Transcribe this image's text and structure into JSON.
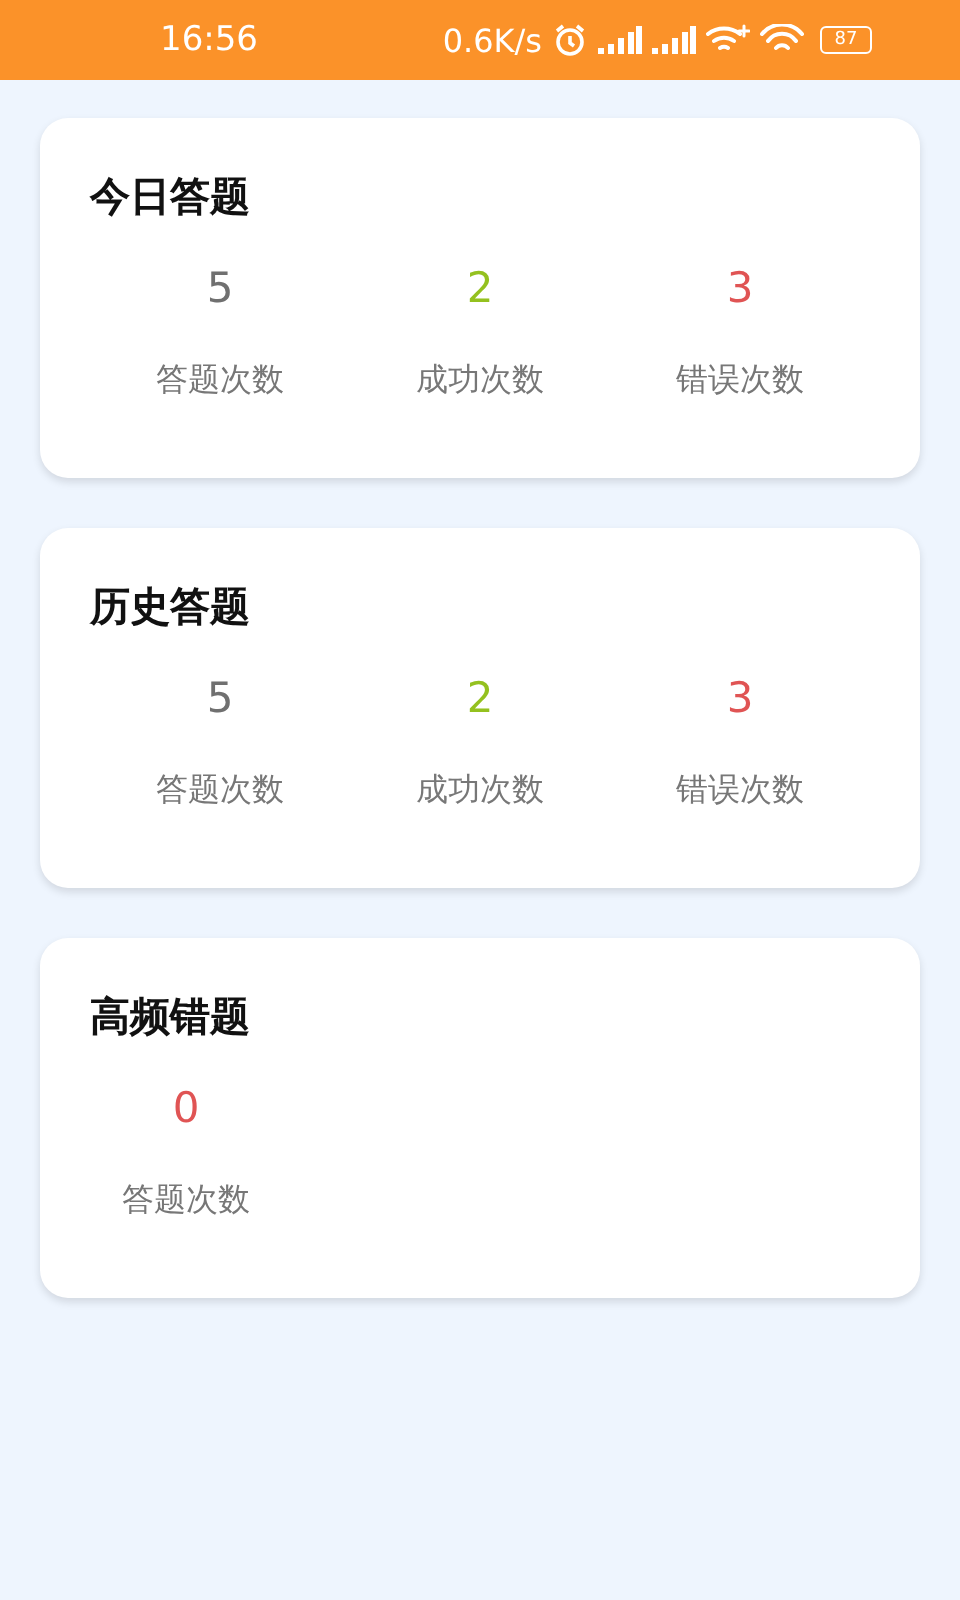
{
  "status_bar": {
    "time": "16:56",
    "speed": "0.6K/s",
    "battery": "87"
  },
  "cards": [
    {
      "title": "今日答题",
      "stats": [
        {
          "value": "5",
          "label": "答题次数",
          "color": "#707070"
        },
        {
          "value": "2",
          "label": "成功次数",
          "color": "#94c11f"
        },
        {
          "value": "3",
          "label": "错误次数",
          "color": "#e05454"
        }
      ]
    },
    {
      "title": "历史答题",
      "stats": [
        {
          "value": "5",
          "label": "答题次数",
          "color": "#707070"
        },
        {
          "value": "2",
          "label": "成功次数",
          "color": "#94c11f"
        },
        {
          "value": "3",
          "label": "错误次数",
          "color": "#e05454"
        }
      ]
    },
    {
      "title": "高频错题",
      "stats": [
        {
          "value": "0",
          "label": "答题次数",
          "color": "#e05454"
        }
      ]
    }
  ]
}
